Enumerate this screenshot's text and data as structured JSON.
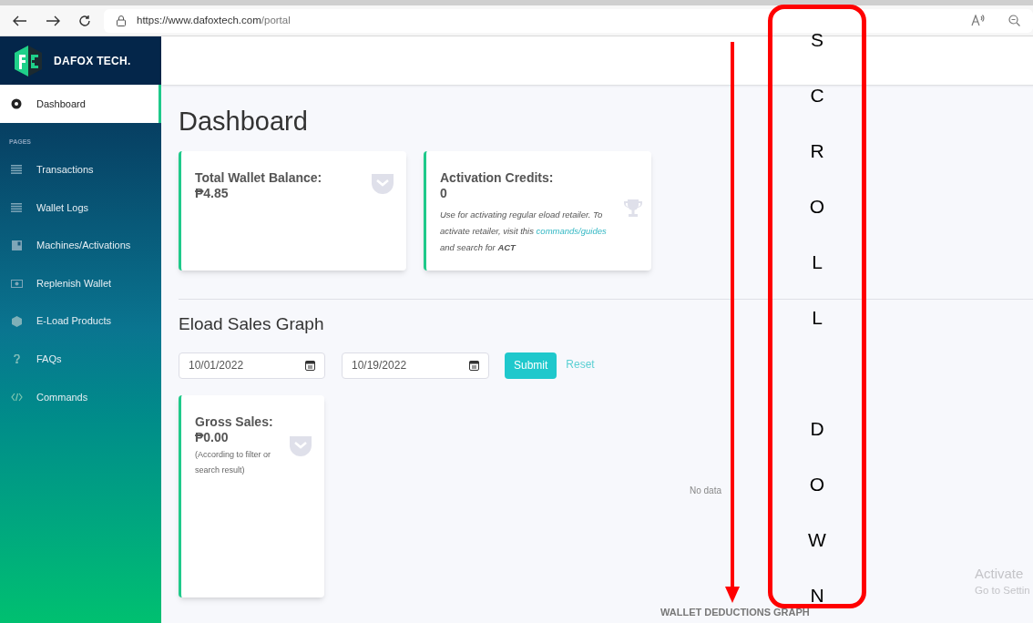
{
  "browser": {
    "url_host": "https://www.dafoxtech.com",
    "url_path": "/portal"
  },
  "brand": {
    "name": "DAFOX TECH."
  },
  "sidebar": {
    "top_items": [
      {
        "label": "Dashboard",
        "selected": true
      }
    ],
    "section": "PAGES",
    "items": [
      {
        "label": "Transactions",
        "selected": false
      },
      {
        "label": "Wallet Logs",
        "selected": false
      },
      {
        "label": "Machines/Activations",
        "selected": false
      },
      {
        "label": "Replenish Wallet",
        "selected": false
      },
      {
        "label": "E-Load Products",
        "selected": false
      },
      {
        "label": "FAQs",
        "selected": false
      },
      {
        "label": "Commands",
        "selected": false
      }
    ]
  },
  "page_title": "Dashboard",
  "cards": [
    {
      "title": "Total Wallet Balance:",
      "value": "₱4.85"
    },
    {
      "title": "Activation Credits:",
      "value": "0",
      "note_before": "Use for activating regular eload retailer. To activate retailer, visit this ",
      "note_link": "commands/guides",
      "note_after": " and search for **ACT**"
    }
  ],
  "sales": {
    "heading": "Eload Sales Graph",
    "date_from": "10/01/2022",
    "date_to": "10/19/2022",
    "submit": "Submit",
    "reset": "Reset",
    "gross": {
      "title": "Gross Sales:",
      "value": "₱0.00",
      "note": "(According to filter or search result)"
    },
    "empty": "No data",
    "next_heading": "WALLET DEDUCTIONS GRAPH"
  },
  "annotation": {
    "words": [
      [
        "S",
        "C",
        "R",
        "O",
        "L",
        "L"
      ],
      [
        "D",
        "O",
        "W",
        "N"
      ]
    ]
  },
  "os_notice": {
    "line1": "Activate",
    "line2": "Go to Settin"
  }
}
